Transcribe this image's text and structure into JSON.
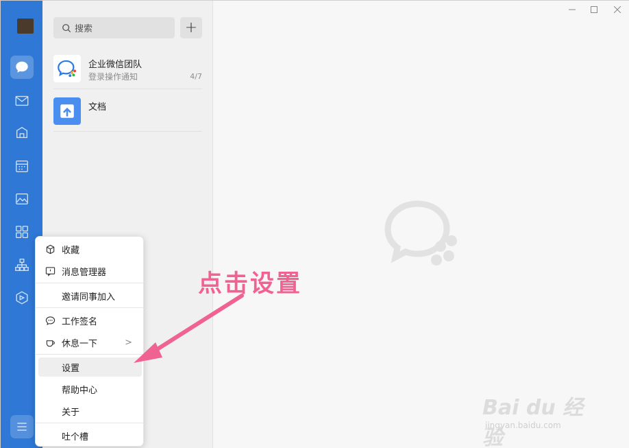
{
  "search": {
    "placeholder": "搜索"
  },
  "add_button": {
    "label": "+"
  },
  "chats": [
    {
      "name": "企业微信团队",
      "preview": "登录操作通知",
      "meta": "4/7"
    },
    {
      "name": "文档",
      "preview": "",
      "meta": ""
    }
  ],
  "rail": {
    "items": [
      "chat-icon",
      "mail-icon",
      "workbench-icon",
      "calendar-icon",
      "gallery-icon",
      "apps-icon",
      "org-chart-icon",
      "cube-icon"
    ],
    "menu_icon": "hamburger-icon"
  },
  "popup_menu": {
    "items": [
      {
        "label": "收藏",
        "icon": "box-icon"
      },
      {
        "label": "消息管理器",
        "icon": "message-manager-icon"
      },
      {
        "label": "邀请同事加入",
        "icon": ""
      },
      {
        "label": "工作签名",
        "icon": "speech-bubble-icon"
      },
      {
        "label": "休息一下",
        "icon": "coffee-cup-icon",
        "chevron": ">"
      },
      {
        "label": "设置",
        "icon": ""
      },
      {
        "label": "帮助中心",
        "icon": ""
      },
      {
        "label": "关于",
        "icon": ""
      },
      {
        "label": "吐个槽",
        "icon": ""
      }
    ]
  },
  "annotation": {
    "text": "点击设置"
  },
  "watermark": {
    "brand": "Bai du 经验",
    "url": "jingyan.baidu.com"
  },
  "colors": {
    "rail": "#2f78d6",
    "annotation": "#f06292",
    "panel": "#f0f0f0"
  }
}
